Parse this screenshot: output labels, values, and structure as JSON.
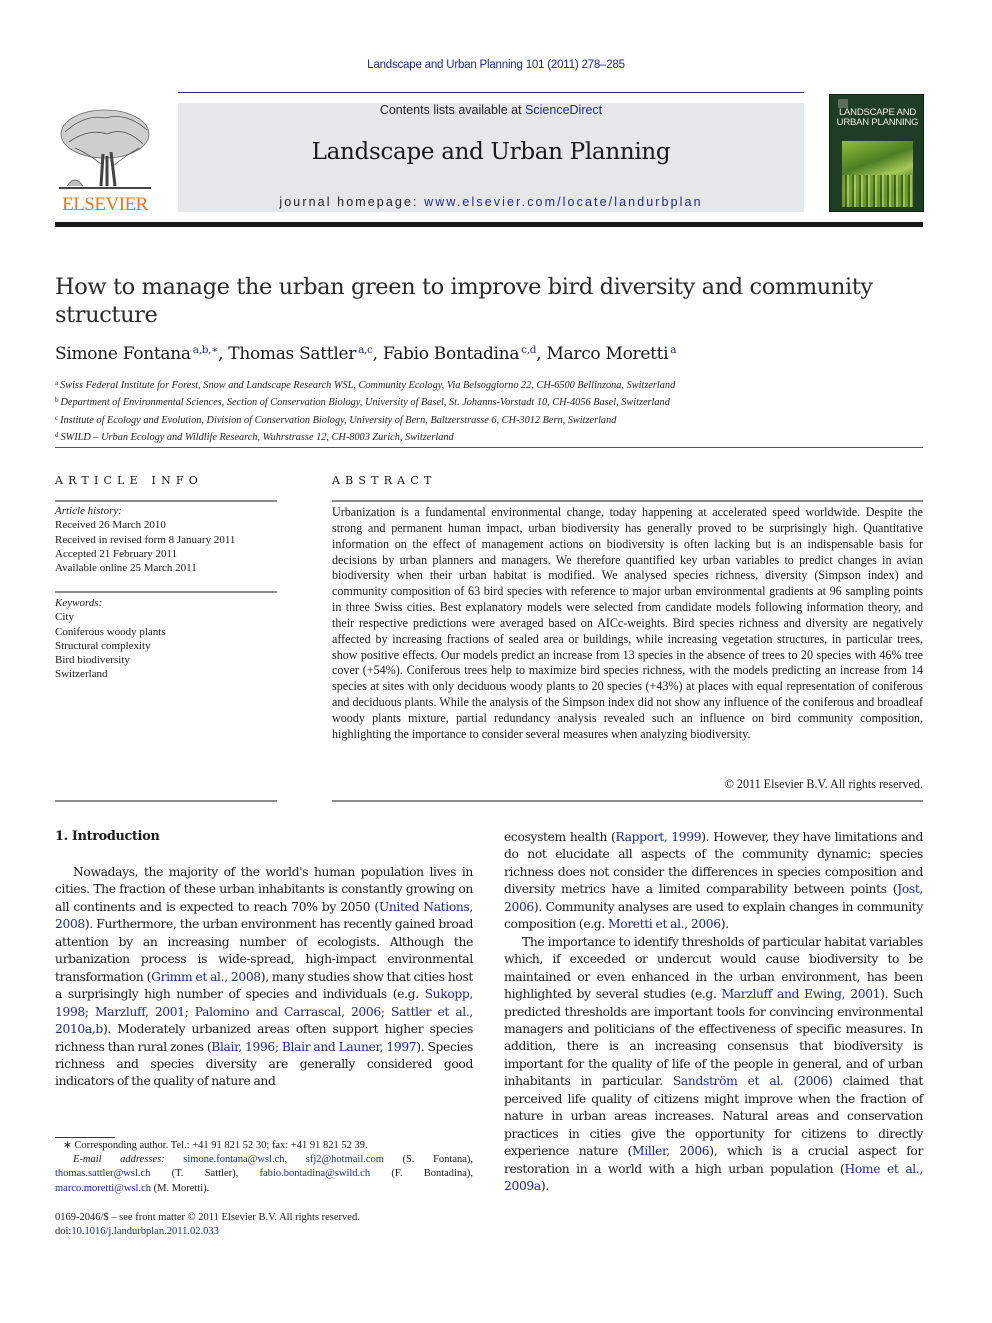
{
  "header": {
    "running_head": "Landscape and Urban Planning 101 (2011) 278–285",
    "publisher_logo_label": "ELSEVIER",
    "contents_prefix": "Contents lists available at ",
    "contents_link": "ScienceDirect",
    "journal_title": "Landscape and Urban Planning",
    "homepage_prefix": "journal homepage: ",
    "homepage_link": "www.elsevier.com/locate/landurbplan",
    "cover_title_line1": "LANDSCAPE AND",
    "cover_title_line2": "URBAN PLANNING"
  },
  "article": {
    "title": "How to manage the urban green to improve bird diversity and community structure",
    "authors": [
      {
        "name": "Simone Fontana",
        "sup": "a,b,∗"
      },
      {
        "name": "Thomas Sattler",
        "sup": "a,c"
      },
      {
        "name": "Fabio Bontadina",
        "sup": "c,d"
      },
      {
        "name": "Marco Moretti",
        "sup": "a"
      }
    ],
    "affiliations": [
      {
        "key": "a",
        "text": "Swiss Federal Institute for Forest, Snow and Landscape Research WSL, Community Ecology, Via Belsoggiorno 22, CH-6500 Bellinzona, Switzerland"
      },
      {
        "key": "b",
        "text": "Department of Environmental Sciences, Section of Conservation Biology, University of Basel, St. Johanns-Vorstadt 10, CH-4056 Basel, Switzerland"
      },
      {
        "key": "c",
        "text": "Institute of Ecology and Evolution, Division of Conservation Biology, University of Bern, Baltzerstrasse 6, CH-3012 Bern, Switzerland"
      },
      {
        "key": "d",
        "text": "SWILD – Urban Ecology and Wildlife Research, Wuhrstrasse 12, CH-8003 Zurich, Switzerland"
      }
    ]
  },
  "article_info": {
    "heading": "ARTICLE INFO",
    "history_label": "Article history:",
    "history": [
      "Received 26 March 2010",
      "Received in revised form 8 January 2011",
      "Accepted 21 February 2011",
      "Available online 25 March 2011"
    ],
    "keywords_label": "Keywords:",
    "keywords": [
      "City",
      "Coniferous woody plants",
      "Structural complexity",
      "Bird biodiversity",
      "Switzerland"
    ]
  },
  "abstract": {
    "heading": "ABSTRACT",
    "text": "Urbanization is a fundamental environmental change, today happening at accelerated speed worldwide. Despite the strong and permanent human impact, urban biodiversity has generally proved to be surprisingly high. Quantitative information on the effect of management actions on biodiversity is often lacking but is an indispensable basis for decisions by urban planners and managers. We therefore quantified key urban variables to predict changes in avian biodiversity when their urban habitat is modified. We analysed species richness, diversity (Simpson index) and community composition of 63 bird species with reference to major urban environmental gradients at 96 sampling points in three Swiss cities. Best explanatory models were selected from candidate models following information theory, and their respective predictions were averaged based on AICc-weights. Bird species richness and diversity are negatively affected by increasing fractions of sealed area or buildings, while increasing vegetation structures, in particular trees, show positive effects. Our models predict an increase from 13 species in the absence of trees to 20 species with 46% tree cover (+54%). Coniferous trees help to maximize bird species richness, with the models predicting an increase from 14 species at sites with only deciduous woody plants to 20 species (+43%) at places with equal representation of coniferous and deciduous plants. While the analysis of the Simpson index did not show any influence of the coniferous and broadleaf woody plants mixture, partial redundancy analysis revealed such an influence on bird community composition, highlighting the importance to consider several measures when analyzing biodiversity.",
    "copyright": "© 2011 Elsevier B.V. All rights reserved."
  },
  "introduction": {
    "heading": "1.  Introduction",
    "p1": [
      {
        "t": "Nowadays, the majority of the world's human population lives in cities. The fraction of these urban inhabitants is constantly growing on all continents and is expected to reach 70% by 2050 ("
      },
      {
        "l": "United Nations, 2008"
      },
      {
        "t": "). Furthermore, the urban environment has recently gained broad attention by an increasing number of ecologists. Although the urbanization process is wide-spread, high-impact environmental transformation ("
      },
      {
        "l": "Grimm et al., 2008"
      },
      {
        "t": "), many studies show that cities host a surprisingly high number of species and individuals (e.g. "
      },
      {
        "l": "Sukopp, 1998; Marzluff, 2001; Palomino and Carrascal, 2006; Sattler et al., 2010a,b"
      },
      {
        "t": "). Moderately urbanized areas often support higher species richness than rural zones ("
      },
      {
        "l": "Blair, 1996; Blair and Launer, 1997"
      },
      {
        "t": "). Species richness and species diversity are generally considered good indicators of the quality of nature and"
      }
    ],
    "p1_right": [
      {
        "t": "ecosystem health ("
      },
      {
        "l": "Rapport, 1999"
      },
      {
        "t": "). However, they have limitations and do not elucidate all aspects of the community dynamic: species richness does not consider the differences in species composition and diversity metrics have a limited comparability between points ("
      },
      {
        "l": "Jost, 2006"
      },
      {
        "t": "). Community analyses are used to explain changes in community composition (e.g. "
      },
      {
        "l": "Moretti et al., 2006"
      },
      {
        "t": ")."
      }
    ],
    "p2": [
      {
        "t": "The importance to identify thresholds of particular habitat variables which, if exceeded or undercut would cause biodiversity to be maintained or even enhanced in the urban environment, has been highlighted by several studies (e.g. "
      },
      {
        "l": "Marzluff and Ewing, 2001"
      },
      {
        "t": "). Such predicted thresholds are important tools for convincing environmental managers and politicians of the effectiveness of specific measures. In addition, there is an increasing consensus that biodiversity is important for the quality of life of the people in general, and of urban inhabitants in particular. "
      },
      {
        "l": "Sandström et al. (2006)"
      },
      {
        "t": " claimed that perceived life quality of citizens might improve when the fraction of nature in urban areas increases. Natural areas and conservation practices in cities give the opportunity for citizens to directly experience nature ("
      },
      {
        "l": "Miller, 2006"
      },
      {
        "t": "), which is a crucial aspect for restoration in a world with a high urban population ("
      },
      {
        "l": "Home et al., 2009a"
      },
      {
        "t": ")."
      }
    ]
  },
  "footnotes": {
    "corresponding": "∗ Corresponding author. Tel.: +41 91 821 52 30; fax: +41 91 821 52 39.",
    "email_label": "E-mail addresses:",
    "email1": "simone.fontana@wsl.ch",
    "email2": "sfj2@hotmail.com",
    "email2_owner": "(S. Fontana),",
    "email3": "thomas.sattler@wsl.ch",
    "email3_owner": "(T. Sattler),",
    "email4": "fabio.bontadina@swild.ch",
    "email4_owner": "(F. Bontadina),",
    "email5": "marco.moretti@wsl.ch",
    "email5_owner": "(M. Moretti).",
    "front_matter": "0169-2046/$ – see front matter © 2011 Elsevier B.V. All rights reserved.",
    "doi_label": "doi:",
    "doi": "10.1016/j.landurbplan.2011.02.033"
  }
}
